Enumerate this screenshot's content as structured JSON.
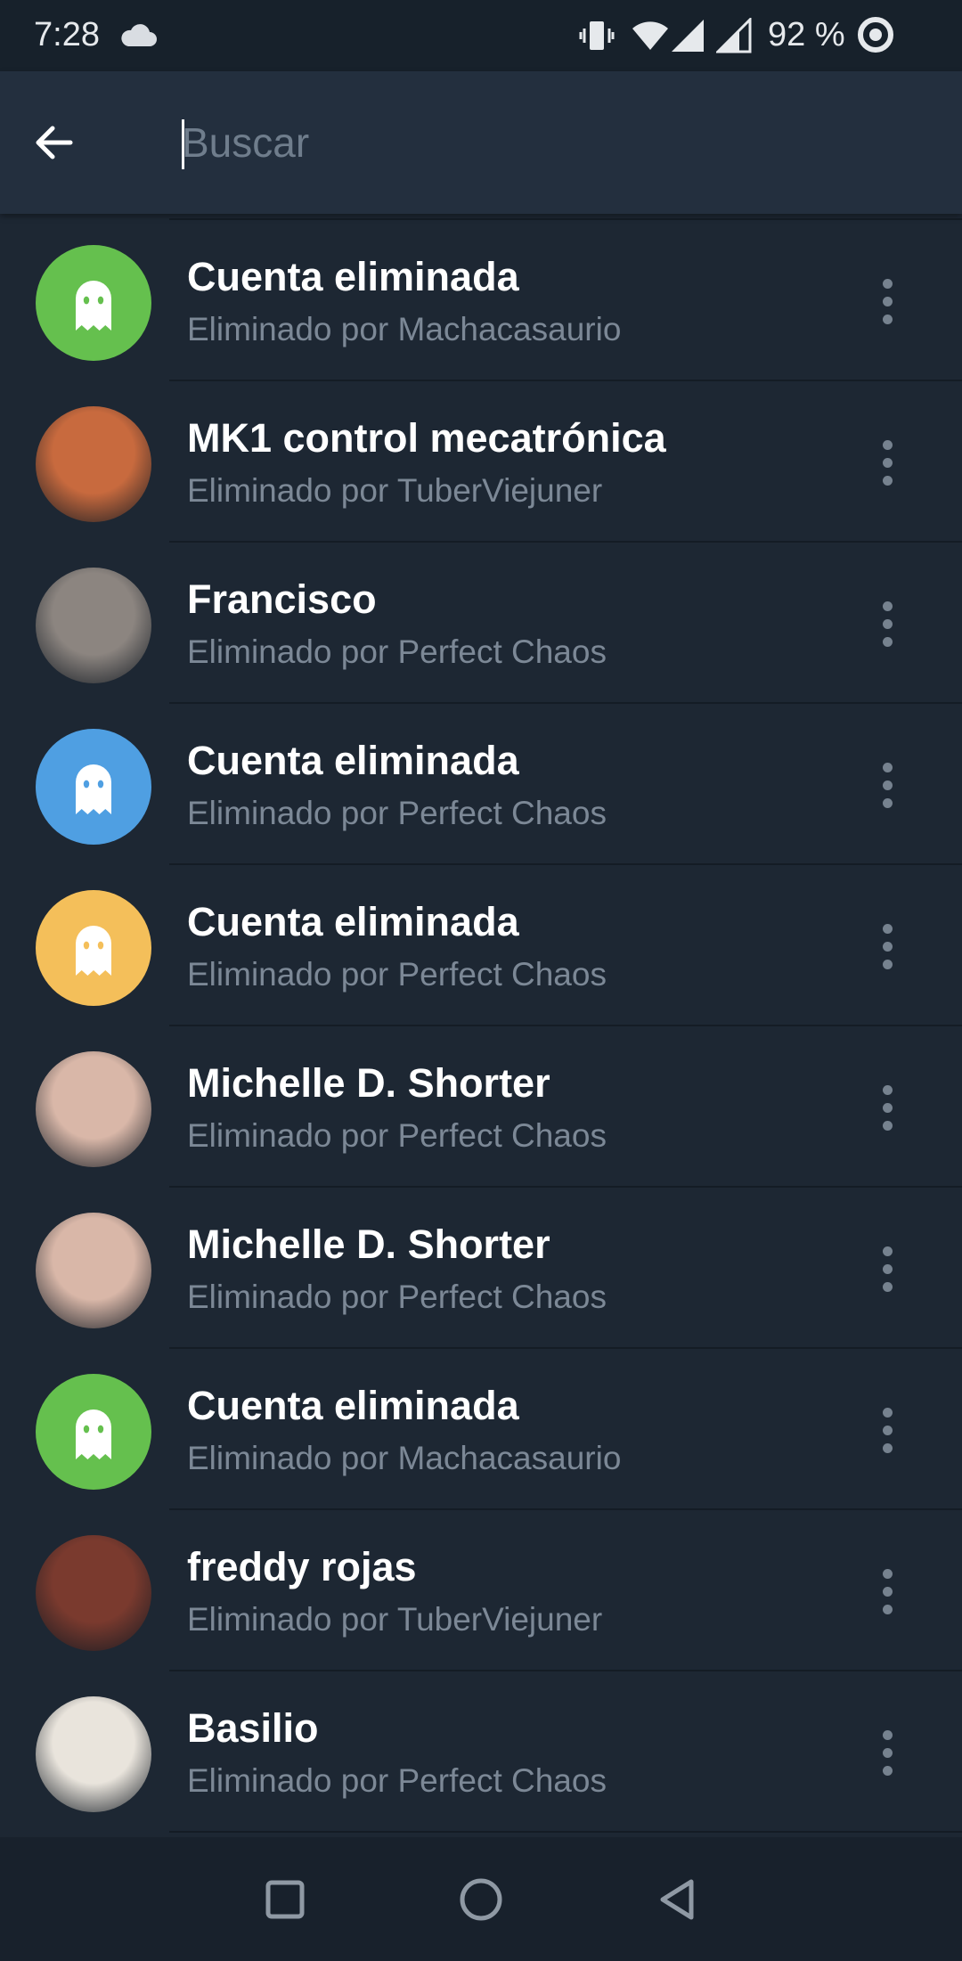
{
  "status_bar": {
    "time": "7:28",
    "battery": "92 %",
    "icons": [
      "cloud-icon",
      "vibrate-icon",
      "wifi-icon",
      "signal-icon",
      "signal-icon",
      "do-not-disturb-icon"
    ]
  },
  "search": {
    "placeholder": "Buscar",
    "value": ""
  },
  "colors": {
    "background": "#1d2733",
    "app_bar": "#232f3e",
    "green_avatar": "#65c04e",
    "blue_avatar": "#4f9fe2",
    "orange_avatar": "#f4bf5a",
    "secondary_text": "#7c8896"
  },
  "members": [
    {
      "name": "Cuenta eliminada",
      "subtitle": "Eliminado por Machacasaurio",
      "avatar": "deleted-account-icon",
      "avatar_color": "#65c04e"
    },
    {
      "name": "MK1 control mecatrónica",
      "subtitle": "Eliminado por TuberViejuner",
      "avatar": "photo",
      "avatar_color": "#c86a3e"
    },
    {
      "name": "Francisco",
      "subtitle": "Eliminado por Perfect Chaos",
      "avatar": "photo",
      "avatar_color": "#8c8580"
    },
    {
      "name": "Cuenta eliminada",
      "subtitle": "Eliminado por Perfect Chaos",
      "avatar": "deleted-account-icon",
      "avatar_color": "#4f9fe2"
    },
    {
      "name": "Cuenta eliminada",
      "subtitle": "Eliminado por Perfect Chaos",
      "avatar": "deleted-account-icon",
      "avatar_color": "#f4bf5a"
    },
    {
      "name": "Michelle D. Shorter",
      "subtitle": "Eliminado por Perfect Chaos",
      "avatar": "photo",
      "avatar_color": "#d9b7a8"
    },
    {
      "name": "Michelle D. Shorter",
      "subtitle": "Eliminado por Perfect Chaos",
      "avatar": "photo",
      "avatar_color": "#d9b7a8"
    },
    {
      "name": "Cuenta eliminada",
      "subtitle": "Eliminado por Machacasaurio",
      "avatar": "deleted-account-icon",
      "avatar_color": "#65c04e"
    },
    {
      "name": "freddy rojas",
      "subtitle": "Eliminado por TuberViejuner",
      "avatar": "photo",
      "avatar_color": "#7a3a2e"
    },
    {
      "name": "Basilio",
      "subtitle": "Eliminado por Perfect Chaos",
      "avatar": "photo",
      "avatar_color": "#e9e4dc"
    }
  ],
  "nav_bar": {
    "buttons": [
      "recents-square-icon",
      "home-circle-icon",
      "back-triangle-icon"
    ]
  }
}
